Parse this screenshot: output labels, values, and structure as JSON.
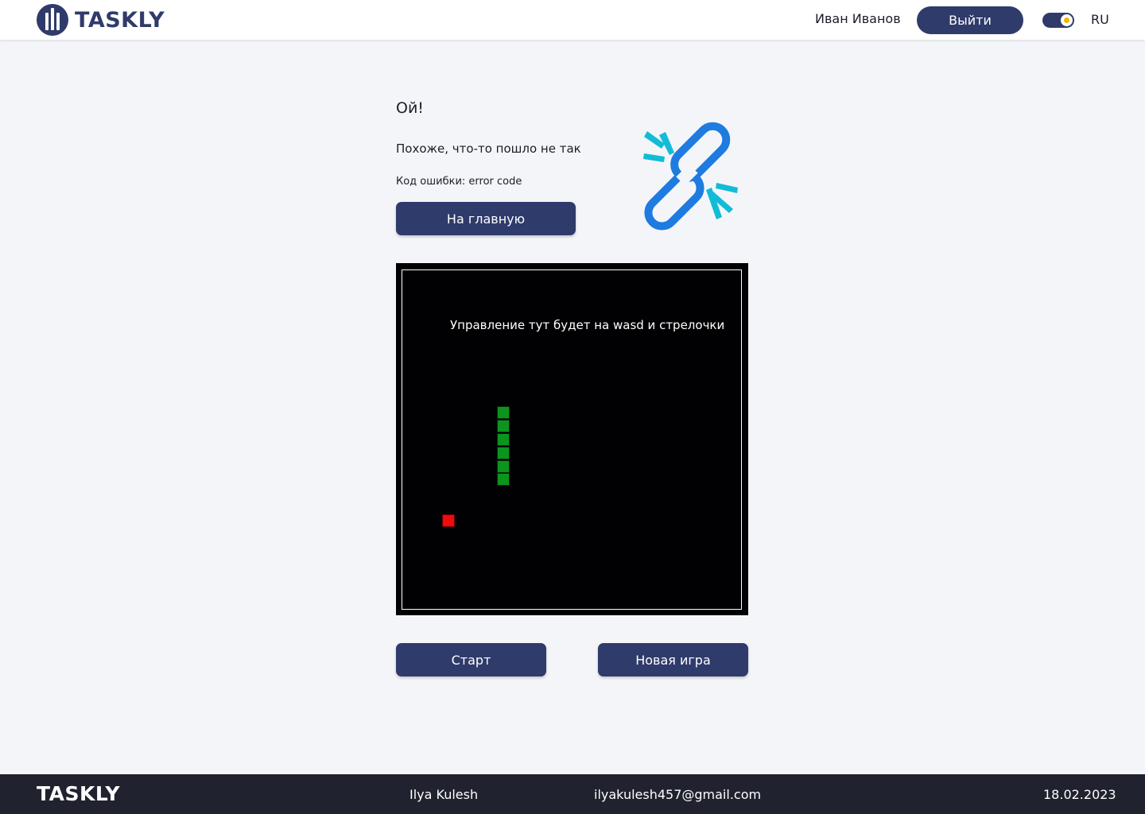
{
  "header": {
    "logo_text": "TASKLY",
    "user_name": "Иван Иванов",
    "logout_label": "Выйти",
    "theme_toggle_state": "on",
    "language": "RU"
  },
  "error": {
    "title": "Ой!",
    "subtitle": "Похоже, что-то пошло не так",
    "code_text": "Код ошибки: error code",
    "home_button_label": "На главную",
    "illustration_icon": "broken-link-icon"
  },
  "game": {
    "hint": "Управление тут будет на wasd и стрелочки",
    "start_label": "Старт",
    "new_game_label": "Новая игра"
  },
  "footer": {
    "logo_text": "TASKLY",
    "author": "Ilya Kulesh",
    "email": "ilyakulesh457@gmail.com",
    "date": "18.02.2023"
  },
  "colors": {
    "primary": "#2f3b6b",
    "background": "#f4f5f9",
    "footer": "#20222f",
    "snake": "#0b951d",
    "food": "#ee0b0b",
    "link_blue": "#1e7be0",
    "link_cyan": "#12bcd6"
  }
}
